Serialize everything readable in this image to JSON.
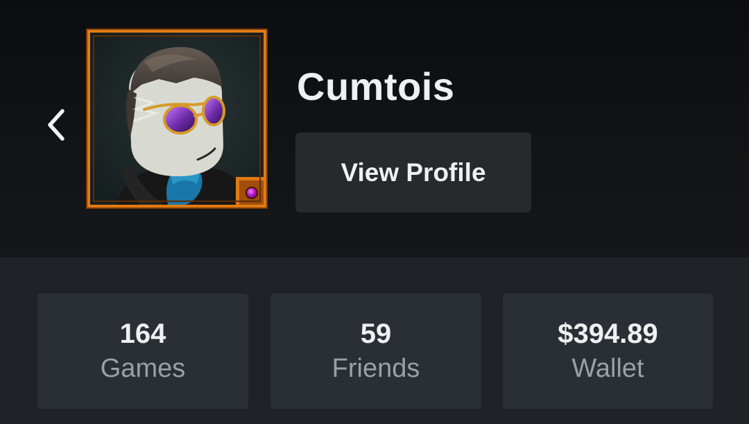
{
  "profile": {
    "username": "Cumtois",
    "view_profile_label": "View Profile"
  },
  "navigation": {
    "back_icon": "chevron-left-icon"
  },
  "avatar": {
    "frame_color": "#e07a12",
    "badge_gem_color": "#b516c7"
  },
  "stats": [
    {
      "value": "164",
      "label": "Games"
    },
    {
      "value": "59",
      "label": "Friends"
    },
    {
      "value": "$394.89",
      "label": "Wallet"
    }
  ],
  "colors": {
    "header_background": "#111316",
    "card_background": "#2a2f35",
    "button_background": "#27292c",
    "primary_text": "#eef0f2",
    "secondary_text": "#9aa0a6"
  }
}
